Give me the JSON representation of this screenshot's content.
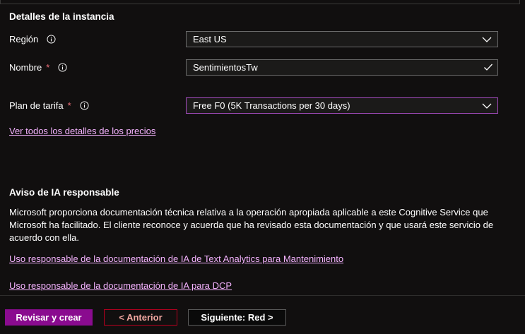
{
  "section_instance": {
    "title": "Detalles de la instancia",
    "region": {
      "label": "Región",
      "value": "East US"
    },
    "name": {
      "label": "Nombre",
      "required_mark": "*",
      "value": "SentimientosTw"
    },
    "pricing": {
      "label": "Plan de tarifa",
      "required_mark": "*",
      "value": "Free F0 (5K Transactions per 30 days)"
    },
    "pricing_link": "Ver todos los detalles de los precios"
  },
  "section_ai": {
    "title": "Aviso de IA responsable",
    "body_lines": [
      "Microsoft proporciona documentación técnica relativa a la operación apropiada aplicable a este Cognitive Service que",
      "Microsoft ha facilitado. El cliente reconoce y acuerda que ha revisado esta documentación y que usará este servicio de",
      "acuerdo con ella."
    ],
    "link_text_analytics": "Uso responsable de la documentación de IA de Text Analytics para Mantenimiento",
    "link_dcp": "Uso responsable de la documentación de IA para DCP"
  },
  "footer": {
    "review_create": "Revisar y crear",
    "previous": "< Anterior",
    "next": "Siguiente: Red >"
  },
  "colors": {
    "accent": "#8a0b8f",
    "link": "#f5b3ff",
    "required": "#f1707b",
    "previous_border": "#b7001f"
  },
  "icons": {
    "info": "info-icon",
    "dropdown": "chevron-down-icon",
    "valid": "checkmark-icon"
  }
}
